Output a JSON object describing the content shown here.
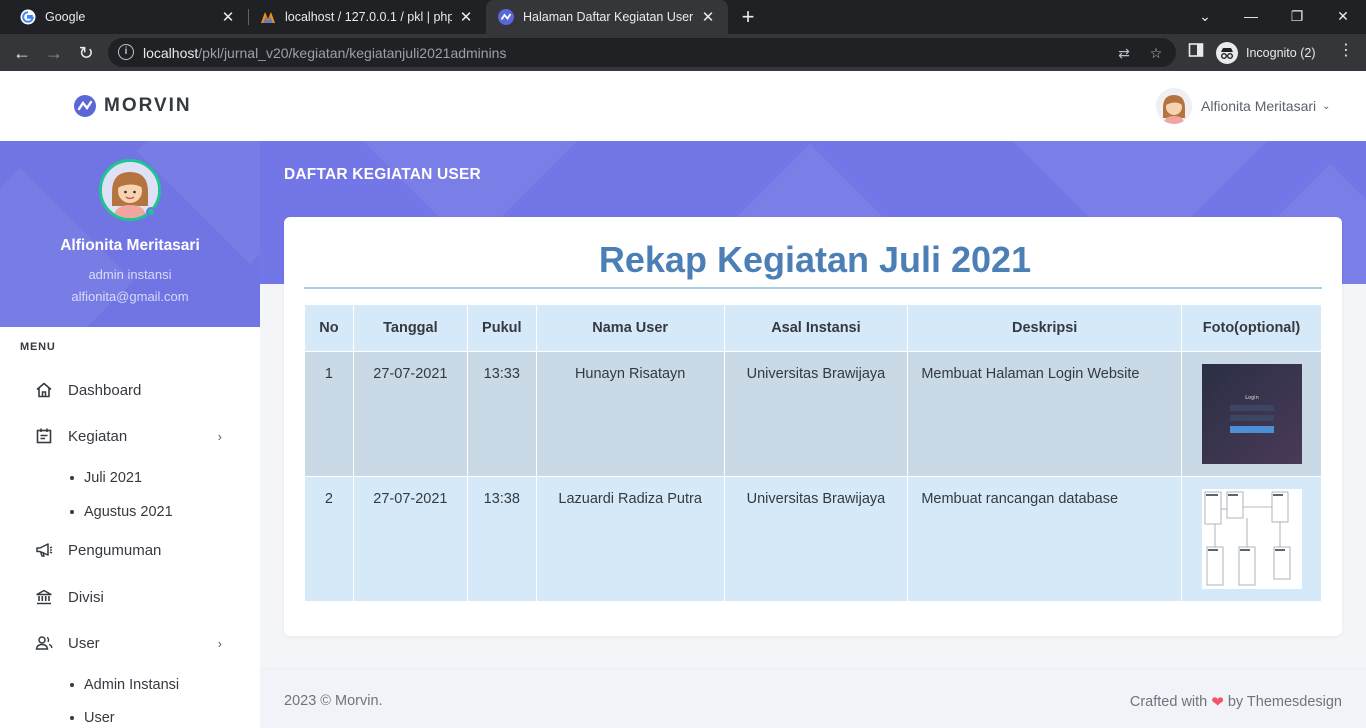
{
  "browser": {
    "tabs": [
      {
        "title": "Google",
        "icon": "google-icon",
        "active": false
      },
      {
        "title": "localhost / 127.0.0.1 / pkl | phpMyAdmin",
        "icon": "phpmyadmin-icon",
        "active": false
      },
      {
        "title": "Halaman Daftar Kegiatan User",
        "icon": "morvin-icon",
        "active": true
      }
    ],
    "url_host": "localhost",
    "url_path": "/pkl/jurnal_v20/kegiatan/kegiatanjuli2021adminins",
    "profile_label": "Incognito (2)"
  },
  "header": {
    "brand": "MORVIN",
    "user_name": "Alfionita Meritasari"
  },
  "sidebar": {
    "profile": {
      "name": "Alfionita Meritasari",
      "role": "admin instansi",
      "email": "alfionita@gmail.com"
    },
    "menu_title": "MENU",
    "items": [
      {
        "label": "Dashboard",
        "icon": "home-icon"
      },
      {
        "label": "Kegiatan",
        "icon": "calendar-icon"
      },
      {
        "label": "Juli 2021"
      },
      {
        "label": "Agustus 2021"
      },
      {
        "label": "Pengumuman",
        "icon": "megaphone-icon"
      },
      {
        "label": "Divisi",
        "icon": "bank-icon"
      },
      {
        "label": "User",
        "icon": "users-icon"
      },
      {
        "label": "Admin Instansi"
      },
      {
        "label": "User"
      }
    ]
  },
  "page": {
    "heading": "DAFTAR KEGIATAN USER",
    "card_title": "Rekap Kegiatan Juli 2021"
  },
  "table": {
    "headers": [
      "No",
      "Tanggal",
      "Pukul",
      "Nama User",
      "Asal Instansi",
      "Deskripsi",
      "Foto(optional)"
    ],
    "rows": [
      {
        "no": "1",
        "tanggal": "27-07-2021",
        "pukul": "13:33",
        "nama": "Hunayn Risatayn",
        "instansi": "Universitas Brawijaya",
        "deskripsi": "Membuat Halaman Login Website",
        "foto": "login-screenshot",
        "foto_text": "Login"
      },
      {
        "no": "2",
        "tanggal": "27-07-2021",
        "pukul": "13:38",
        "nama": "Lazuardi Radiza Putra",
        "instansi": "Universitas Brawijaya",
        "deskripsi": "Membuat rancangan database",
        "foto": "database-diagram",
        "foto_text": ""
      }
    ]
  },
  "footer": {
    "copyright": "2023 © Morvin.",
    "crafted_prefix": "Crafted with",
    "crafted_suffix": "by Themesdesign"
  },
  "colors": {
    "banner": "#7276e6",
    "title_blue": "#4b7fb5",
    "header_row": "#d6e9f9",
    "row1": "#c9d9e6",
    "online": "#1ec68f"
  }
}
